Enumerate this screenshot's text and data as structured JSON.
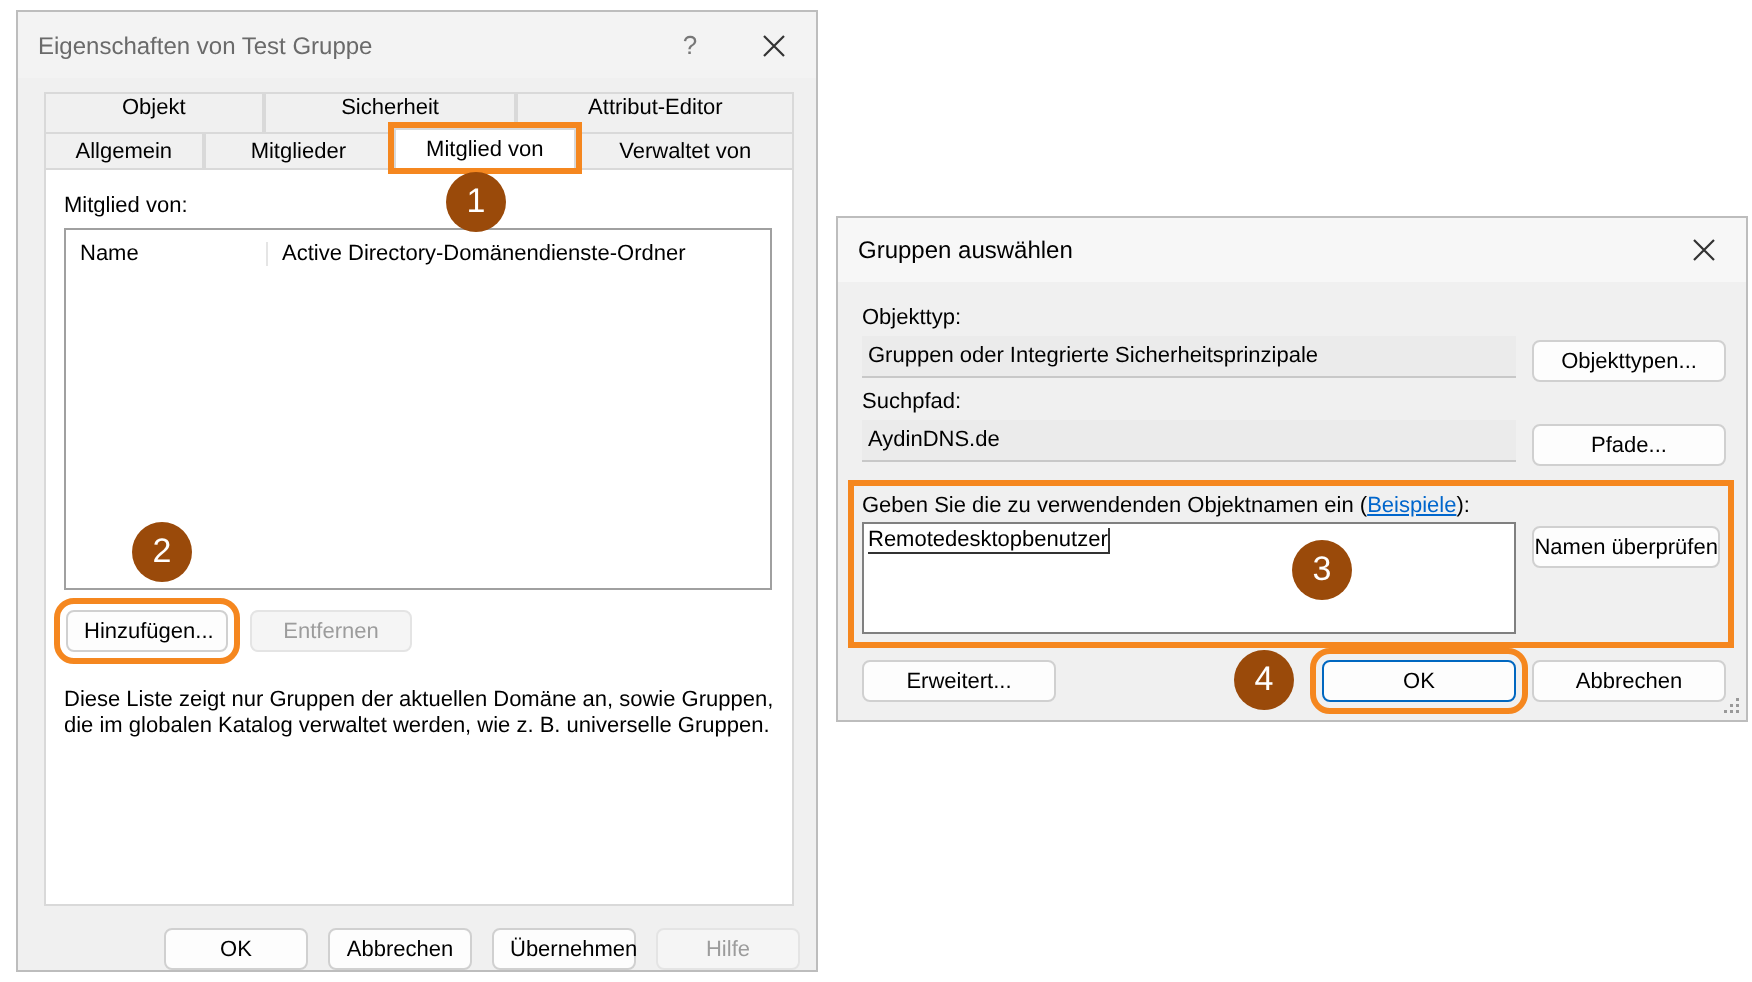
{
  "properties_dialog": {
    "title": "Eigenschaften von Test Gruppe",
    "help_button": "?",
    "tab_rows": [
      [
        {
          "label": "Objekt",
          "selected": false,
          "highlighted": false
        },
        {
          "label": "Sicherheit",
          "selected": false,
          "highlighted": false
        },
        {
          "label": "Attribut-Editor",
          "selected": false,
          "highlighted": false
        }
      ],
      [
        {
          "label": "Allgemein",
          "selected": false,
          "highlighted": false
        },
        {
          "label": "Mitglieder",
          "selected": false,
          "highlighted": false
        },
        {
          "label": "Mitglied von",
          "selected": true,
          "highlighted": true
        },
        {
          "label": "Verwaltet von",
          "selected": false,
          "highlighted": false
        }
      ]
    ],
    "section_label": "Mitglied von:",
    "list": {
      "columns": [
        "Name",
        "Active Directory-Domänendienste-Ordner"
      ]
    },
    "list_buttons": [
      {
        "label": "Hinzufügen...",
        "disabled": false,
        "highlighted": true
      },
      {
        "label": "Entfernen",
        "disabled": true,
        "highlighted": false
      }
    ],
    "note": "Diese Liste zeigt nur Gruppen der aktuellen Domäne an, sowie Gruppen, die im globalen Katalog verwaltet werden, wie z. B. universelle Gruppen.",
    "footer_buttons": [
      {
        "label": "OK",
        "disabled": false
      },
      {
        "label": "Abbrechen",
        "disabled": false
      },
      {
        "label": "Übernehmen",
        "disabled": false
      },
      {
        "label": "Hilfe",
        "disabled": true
      }
    ]
  },
  "select_dialog": {
    "title": "Gruppen auswählen",
    "fields": [
      {
        "label": "Objekttyp:",
        "value": "Gruppen oder Integrierte Sicherheitsprinzipale",
        "button": "Objekttypen..."
      },
      {
        "label": "Suchpfad:",
        "value": "AydinDNS.de",
        "button": "Pfade..."
      }
    ],
    "names": {
      "label": "Geben Sie die zu verwendenden Objektnamen ein (",
      "link": "Beispiele",
      "label_end": "):",
      "value": "Remotedesktopbenutzer",
      "button": "Namen überprüfen",
      "highlighted": true
    },
    "footer_buttons": [
      {
        "label": "Erweitert...",
        "default": false,
        "highlighted": false
      },
      {
        "label": "OK",
        "default": true,
        "highlighted": true
      },
      {
        "label": "Abbrechen",
        "default": false,
        "highlighted": false
      }
    ]
  },
  "callouts": [
    "1",
    "2",
    "3",
    "4"
  ]
}
